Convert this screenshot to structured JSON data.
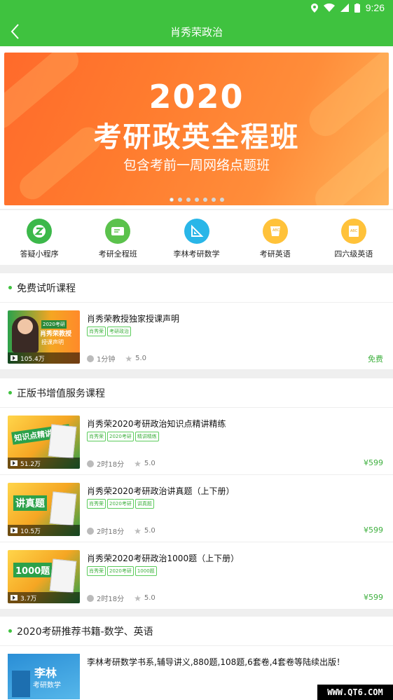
{
  "status": {
    "time": "9:26"
  },
  "appbar": {
    "title": "肖秀荣政治"
  },
  "banner": {
    "year": "2020",
    "course": "考研政英全程班",
    "sub": "包含考前一周网络点题班",
    "dots": 7
  },
  "quick": [
    {
      "label": "答疑小程序",
      "icon": "z-icon",
      "color": "#3cb84a"
    },
    {
      "label": "考研全程班",
      "icon": "ticket-icon",
      "color": "#5bc24c"
    },
    {
      "label": "李林考研数学",
      "icon": "ruler-icon",
      "color": "#29b6e8"
    },
    {
      "label": "考研英语",
      "icon": "abc-icon",
      "color": "#ffc23a"
    },
    {
      "label": "四六级英语",
      "icon": "abc-book-icon",
      "color": "#ffc23a"
    }
  ],
  "free_section": {
    "title": "免费试听课程",
    "course": {
      "title": "肖秀荣教授独家授课声明",
      "tags": [
        "肖秀荣",
        "考研政治"
      ],
      "views": "105.4万",
      "duration": "1分钟",
      "rating": "5.0",
      "price": "免费",
      "thumb_caption": "肖秀荣教授",
      "thumb_caption2": "2020考研",
      "thumb_caption3": "授课声明"
    }
  },
  "book_section": {
    "title": "正版书增值服务课程",
    "courses": [
      {
        "title": "肖秀荣2020考研政治知识点精讲精练",
        "tags": [
          "肖秀荣",
          "2020考研",
          "精讲精练"
        ],
        "views": "51.2万",
        "duration": "2时18分",
        "rating": "5.0",
        "price": "¥599",
        "cover": "知识点精讲精练"
      },
      {
        "title": "肖秀荣2020考研政治讲真题（上下册）",
        "tags": [
          "肖秀荣",
          "2020考研",
          "讲真题"
        ],
        "views": "10.5万",
        "duration": "2时18分",
        "rating": "5.0",
        "price": "¥599",
        "cover": "讲真题"
      },
      {
        "title": "肖秀荣2020考研政治1000题（上下册）",
        "tags": [
          "肖秀荣",
          "2020考研",
          "1000题"
        ],
        "views": "3.7万",
        "duration": "2时18分",
        "rating": "5.0",
        "price": "¥599",
        "cover": "1000题"
      }
    ]
  },
  "rec_section": {
    "title": "2020考研推荐书籍-数学、英语",
    "book": {
      "text": "李林考研数学书系,辅导讲义,880题,108题,6套卷,4套卷等陆续出版！",
      "cover": "李林",
      "cover2": "考研数学"
    }
  },
  "watermark": "WWW.QT6.COM"
}
